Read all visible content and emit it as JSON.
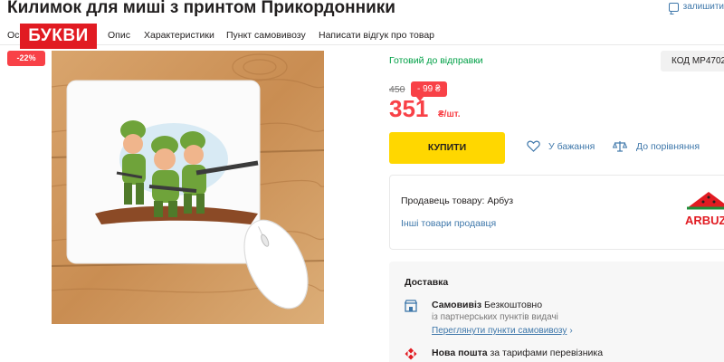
{
  "product": {
    "title": "Килимок для миші з принтом Прикордонники",
    "favorite_label": "залишити"
  },
  "logo_text": "БУКВИ",
  "tabs": [
    "Ос",
    "Опис",
    "Характеристики",
    "Пункт самовивозу",
    "Написати відгук про товар"
  ],
  "sale_badge": "-22%",
  "status": "Готовий до відправки",
  "code": "КОД MP4702",
  "pricing": {
    "old_price": "450",
    "discount": "- 99 ₴",
    "price": "351",
    "unit": "₴/шт."
  },
  "actions": {
    "buy": "КУПИТИ",
    "wishlist": "У бажання",
    "compare": "До порівняння"
  },
  "seller": {
    "label": "Продавець товару:",
    "name": "Арбуз",
    "link": "Інші товари продавця",
    "logo_text": "ARBUZ"
  },
  "delivery": {
    "title": "Доставка",
    "pickup_title": "Самовивіз",
    "pickup_price": "Безкоштовно",
    "pickup_sub": "із партнерських пунктів видачі",
    "pickup_link": "Переглянути пункти самовивозу",
    "nova_title": "Нова пошта",
    "nova_price": "за тарифами перевізника"
  },
  "colors": {
    "accent_red": "#f84147",
    "buy_yellow": "#ffd700",
    "link_blue": "#3e77aa",
    "ready_green": "#00a046"
  }
}
